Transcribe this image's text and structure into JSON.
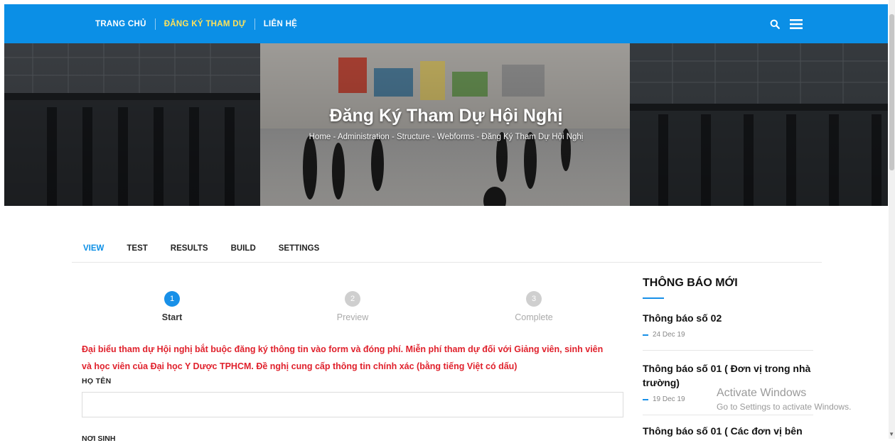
{
  "nav": {
    "items": [
      {
        "label": "TRANG CHỦ"
      },
      {
        "label": "ĐĂNG KÝ THAM DỰ"
      },
      {
        "label": "LIÊN HỆ"
      }
    ],
    "icons": [
      "search-icon",
      "hamburger-menu-icon"
    ]
  },
  "hero": {
    "title": "Đăng Ký Tham Dự Hội Nghị",
    "breadcrumb": [
      "Home",
      "Administration",
      "Structure",
      "Webforms",
      "Đăng Ký Tham Dự Hội Nghị"
    ],
    "separator": " - "
  },
  "tabs": [
    "VIEW",
    "TEST",
    "RESULTS",
    "BUILD",
    "SETTINGS"
  ],
  "steps": [
    {
      "number": "1",
      "label": "Start"
    },
    {
      "number": "2",
      "label": "Preview"
    },
    {
      "number": "3",
      "label": "Complete"
    }
  ],
  "form": {
    "notice_line1": "Đại biểu tham dự Hội nghị bắt buộc đăng ký thông tin vào form và đóng phí. Miễn phí tham dự đối với Giảng viên, sinh viên",
    "notice_line2": "và học viên của Đại học Y Dược TPHCM. Đề nghị cung cấp thông tin chính xác (bằng tiếng Việt có dấu)",
    "name_label": "HỌ TÊN",
    "name_value": "",
    "birthplace_label": "NƠI SINH"
  },
  "sidebar": {
    "title": "THÔNG BÁO MỚI",
    "news": [
      {
        "title": "Thông báo số 02",
        "date": "24 Dec 19"
      },
      {
        "title": "Thông báo số 01 ( Đơn vị trong nhà trường)",
        "date": "19 Dec 19"
      },
      {
        "title": "Thông báo số 01 ( Các đơn vị bên",
        "date": ""
      }
    ]
  },
  "watermark": {
    "line1": "Activate Windows",
    "line2": "Go to Settings to activate Windows."
  },
  "colors": {
    "header_blue": "#0b8fe6",
    "nav_active": "#ffe25a",
    "notice_red": "#e0212c",
    "accent": "#1890e8"
  }
}
